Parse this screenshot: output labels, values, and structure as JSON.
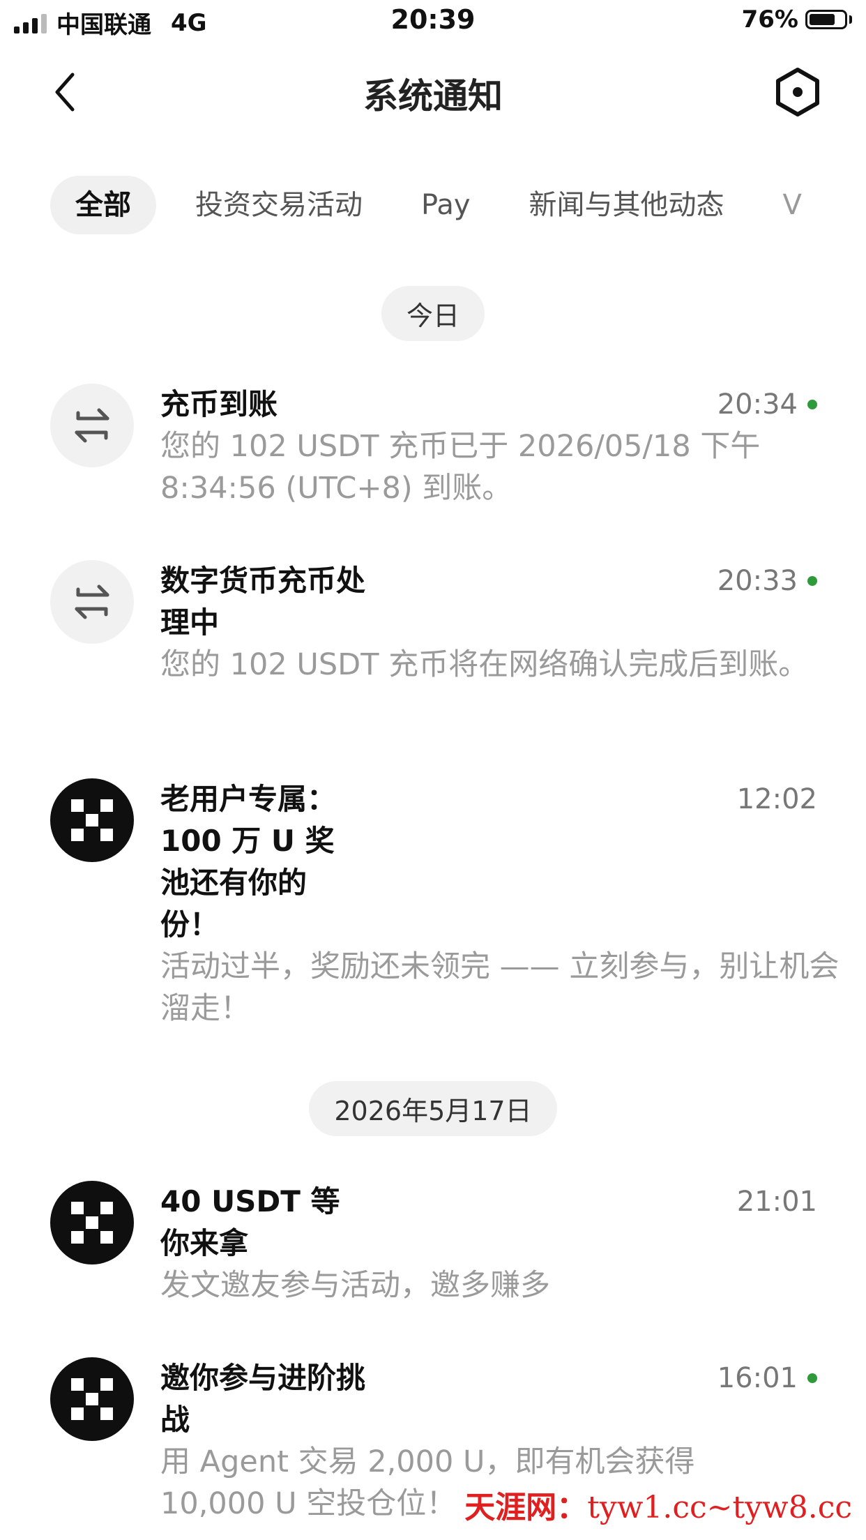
{
  "status_bar": {
    "carrier": "中国联通",
    "network": "4G",
    "time": "20:39",
    "battery": "76%",
    "battery_level": 0.76
  },
  "header": {
    "title": "系统通知",
    "back_icon": "chevron-left-icon",
    "settings_icon": "hexagon-settings-icon"
  },
  "tabs": [
    "全部",
    "投资交易活动",
    "Pay",
    "新闻与其他动态",
    "V"
  ],
  "sections": [
    {
      "date_label": "今日"
    },
    {
      "date_label": "2026年5月17日"
    }
  ],
  "notifications": [
    {
      "title": "充币到账",
      "time": "20:34",
      "unread": true,
      "body": "您的 102 USDT 充币已于 2026/05/18 下午 8:34:56 (UTC+8) 到账。",
      "icon": "transfer-arrows-icon"
    },
    {
      "title": "数字货币充币处理中",
      "time": "20:33",
      "unread": true,
      "body": "您的 102 USDT 充币将在网络确认完成后到账。",
      "icon": "transfer-arrows-icon"
    },
    {
      "title": "老用户专属：100 万 U 奖池还有你的份！",
      "time": "12:02",
      "unread": false,
      "body": "活动过半，奖励还未领完 —— 立刻参与，别让机会溜走！",
      "icon": "okx-logo-icon"
    },
    {
      "title": "40 USDT 等你来拿",
      "time": "21:01",
      "unread": false,
      "body": "发文邀友参与活动，邀多赚多",
      "icon": "okx-logo-icon"
    },
    {
      "title": "邀你参与进阶挑战",
      "time": "16:01",
      "unread": true,
      "body": "用 Agent 交易 2,000 U，即有机会获得 10,000 U 空投仓位！",
      "icon": "okx-logo-icon"
    }
  ],
  "watermark": {
    "site": "天涯网：",
    "url": "tyw1.cc~tyw8.cc"
  },
  "colors": {
    "unread_dot": "#2e9a3b",
    "watermark": "#e02020"
  }
}
